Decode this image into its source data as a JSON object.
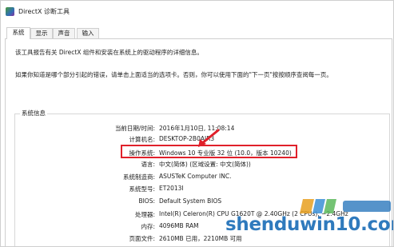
{
  "window": {
    "title": "DirectX 诊断工具"
  },
  "tabs": [
    {
      "label": "系统",
      "active": true
    },
    {
      "label": "显示",
      "active": false
    },
    {
      "label": "声音",
      "active": false
    },
    {
      "label": "输入",
      "active": false
    }
  ],
  "intro_text": "该工具报告有关 DirectX 组件和安装在系统上的驱动程序的详细信息。",
  "hint_text": "如果你知道是哪个部分引起的错误，请单击上面适当的选项卡。否则，你可以使用下面的\"下一页\"按按顺序查阅每一页。",
  "system_info": {
    "group_title": "系统信息",
    "rows": [
      {
        "label": "当前日期/时间:",
        "value": "2016年1月10日, 11:08:14"
      },
      {
        "label": "计算机名:",
        "value": "DESKTOP-2B0AIR3"
      },
      {
        "label": "操作系统:",
        "value": "Windows 10 专业版 32 位 (10.0，版本 10240)"
      },
      {
        "label": "语言:",
        "value": "中文(简体) (区域设置: 中文(简体))"
      },
      {
        "label": "系统制造商:",
        "value": "ASUSTeK Computer INC."
      },
      {
        "label": "系统型号:",
        "value": "ET2013I"
      },
      {
        "label": "BIOS:",
        "value": "Default System BIOS"
      },
      {
        "label": "处理器:",
        "value": "Intel(R) Celeron(R) CPU G1620T @ 2.40GHz (2 CPUs), ~2.4GHz"
      },
      {
        "label": "内存:",
        "value": "4096MB RAM"
      },
      {
        "label": "页面文件:",
        "value": "2610MB 已用，2210MB 可用"
      },
      {
        "label": "",
        "value": ""
      }
    ]
  },
  "watermark": {
    "text": "shenduwin10.com",
    "color": "#1e6fb8"
  },
  "colors": {
    "highlight": "#e0202a",
    "border": "#cfcfcf"
  },
  "icons": {
    "app": "directx-app-icon",
    "arrow": "red-arrow-icon"
  }
}
